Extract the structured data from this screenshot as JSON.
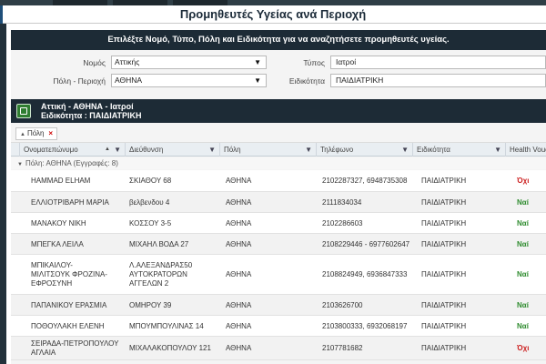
{
  "page": {
    "title": "Προμηθευτές Υγείας ανά Περιοχή"
  },
  "search": {
    "instructions": "Επιλέξτε Νομό, Τύπο, Πόλη και Ειδικότητα για να αναζητήσετε προμηθευτές υγείας.",
    "nomos_label": "Νομός",
    "nomos_value": "Αττικής",
    "typos_label": "Τύπος",
    "typos_value": "Ιατροί",
    "poli_label": "Πόλη - Περιοχή",
    "poli_value": "ΑΘΗΝΑ",
    "eidikotita_label": "Ειδικότητα",
    "eidikotita_value": "ΠΑΙΔΙΑΤΡΙΚΗ"
  },
  "results": {
    "header_line1": "Αττική -  ΑΘΗΝΑ -  Ιατροί",
    "header_line2": "Ειδικότητα : ΠΑΙΔΙΑΤΡΙΚΗ",
    "group_chip": "Πόλη",
    "group_row": "Πόλη: ΑΘΗΝΑ (Εγγραφές: 8)"
  },
  "columns": [
    "Ονοματεπώνυμο",
    "Διεύθυνση",
    "Πόλη",
    "Τηλέφωνο",
    "Ειδικότητα",
    "Health Voucher"
  ],
  "icons": {
    "sort": "sort-up-icon",
    "filter": "filter-icon",
    "group": "group-icon",
    "remove": "close-icon",
    "dropdown": "chevron-down-icon"
  },
  "colors": {
    "header_bg": "#1d2b36",
    "yes": "#2e8b2e",
    "no": "#cc1f1f"
  },
  "rows": [
    {
      "name": [
        "HAMMAD ELHAM"
      ],
      "address": [
        "ΣΚΙΑΘΟΥ 68"
      ],
      "city": "ΑΘΗΝΑ",
      "phone": "2102287327, 6948735308",
      "specialty": "ΠΑΙΔΙΑΤΡΙΚΗ",
      "voucher": "Όχι"
    },
    {
      "name": [
        "ΕΛΛΙΟΤΡΙΒΑΡΗ ΜΑΡΙΑ"
      ],
      "address": [
        "βελβενδου 4"
      ],
      "city": "ΑΘΗΝΑ",
      "phone": "2111834034",
      "specialty": "ΠΑΙΔΙΑΤΡΙΚΗ",
      "voucher": "Ναί"
    },
    {
      "name": [
        "ΜΑΝΑΚΟΥ ΝΙΚΗ"
      ],
      "address": [
        "ΚΟΣΣΟΥ 3-5"
      ],
      "city": "ΑΘΗΝΑ",
      "phone": "2102286603",
      "specialty": "ΠΑΙΔΙΑΤΡΙΚΗ",
      "voucher": "Ναί"
    },
    {
      "name": [
        "ΜΠΕΓΚΑ ΛΕΙΛΑ"
      ],
      "address": [
        "ΜΙΧΑΗΛ ΒΟΔΑ 27"
      ],
      "city": "ΑΘΗΝΑ",
      "phone": "2108229446 - 6977602647",
      "specialty": "ΠΑΙΔΙΑΤΡΙΚΗ",
      "voucher": "Ναί"
    },
    {
      "name": [
        "ΜΠΙΚΑΙΛΟΥ-",
        "ΜΙΛΙΤΣΟΥΚ ΦΡΟΖΙΝΑ-",
        "ΕΦΡΟΣΥΝΗ"
      ],
      "address": [
        "Λ.ΑΛΕΞΑΝΔΡΑΣ50",
        "ΑΥΤΟΚΡΑΤΟΡΩΝ",
        "ΑΓΓΕΛΩΝ 2"
      ],
      "city": "ΑΘΗΝΑ",
      "phone": "2108824949, 6936847333",
      "specialty": "ΠΑΙΔΙΑΤΡΙΚΗ",
      "voucher": "Ναί"
    },
    {
      "name": [
        "ΠΑΠΑΝΙΚΟΥ ΕΡΑΣΜΙΑ"
      ],
      "address": [
        "ΟΜΗΡΟΥ 39"
      ],
      "city": "ΑΘΗΝΑ",
      "phone": "2103626700",
      "specialty": "ΠΑΙΔΙΑΤΡΙΚΗ",
      "voucher": "Ναί"
    },
    {
      "name": [
        "ΠΟΘΟΥΛΑΚΗ ΕΛΕΝΗ"
      ],
      "address": [
        "ΜΠΟΥΜΠΟΥΛΙΝΑΣ 14"
      ],
      "city": "ΑΘΗΝΑ",
      "phone": "2103800333, 6932068197",
      "specialty": "ΠΑΙΔΙΑΤΡΙΚΗ",
      "voucher": "Ναί"
    },
    {
      "name": [
        "ΣΕΙΡΑΔΑ-ΠΕΤΡΟΠΟΥΛΟΥ",
        "ΑΓΛΑΙΑ"
      ],
      "address": [
        "ΜΙΧΑΛΑΚΟΠΟΥΛΟΥ 121"
      ],
      "city": "ΑΘΗΝΑ",
      "phone": "2107781682",
      "specialty": "ΠΑΙΔΙΑΤΡΙΚΗ",
      "voucher": "Όχι"
    }
  ]
}
